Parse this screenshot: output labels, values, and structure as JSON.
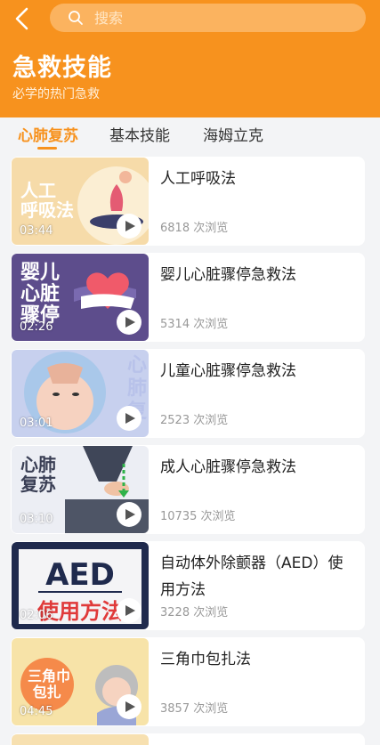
{
  "header": {
    "search_placeholder": "搜索",
    "title": "急救技能",
    "subtitle": "必学的热门急救"
  },
  "tabs": [
    {
      "label": "心肺复苏",
      "active": true
    },
    {
      "label": "基本技能",
      "active": false
    },
    {
      "label": "海姆立克",
      "active": false
    }
  ],
  "colors": {
    "accent": "#f7921e"
  },
  "videos": [
    {
      "thumb_caption": "人工\n呼吸法",
      "duration": "03:44",
      "title": "人工呼吸法",
      "views": "6818 次浏览"
    },
    {
      "thumb_caption": "婴儿\n心脏\n骤停",
      "duration": "02:26",
      "title": "婴儿心脏骤停急救法",
      "views": "5314 次浏览"
    },
    {
      "thumb_caption": "心肺复苏",
      "duration": "03:01",
      "title": "儿童心脏骤停急救法",
      "views": "2523 次浏览"
    },
    {
      "thumb_caption": "心肺\n复苏",
      "duration": "03:10",
      "title": "成人心脏骤停急救法",
      "views": "10735 次浏览"
    },
    {
      "thumb_caption": "AED\n使用方法",
      "duration": "02:06",
      "title": "自动体外除颤器（AED）使用方法",
      "views": "3228 次浏览"
    },
    {
      "thumb_caption": "三角巾\n包扎",
      "duration": "04:45",
      "title": "三角巾包扎法",
      "views": "3857 次浏览"
    }
  ]
}
